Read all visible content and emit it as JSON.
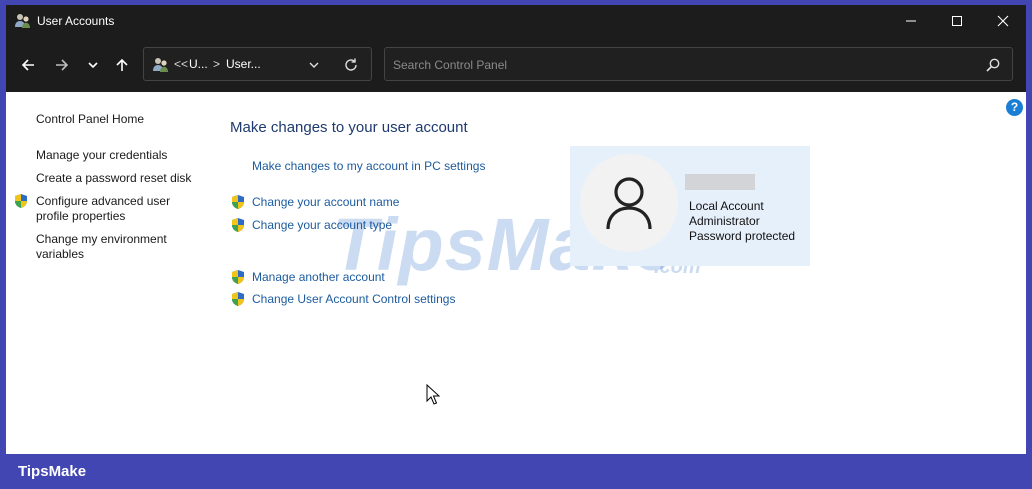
{
  "window": {
    "title": "User Accounts",
    "app_icon": "user-accounts-icon"
  },
  "navbar": {
    "address": {
      "overflow": "<<",
      "crumb1": "U...",
      "separator": ">",
      "crumb2": "User..."
    },
    "search": {
      "placeholder": "Search Control Panel"
    }
  },
  "leftnav": {
    "home": "Control Panel Home",
    "items": [
      "Manage your credentials",
      "Create a password reset disk",
      "Configure advanced user",
      "profile properties",
      "Change my environment",
      "variables"
    ]
  },
  "main": {
    "title": "Make changes to your user account",
    "pc_settings_link": "Make changes to my account in PC settings",
    "tasks": [
      "Change your account name",
      "Change your account type",
      "Manage another account",
      "Change User Account Control settings"
    ]
  },
  "account": {
    "lines": [
      "Local Account",
      "Administrator",
      "Password protected"
    ]
  },
  "watermark": {
    "text": "TipsMake",
    "suffix": ".com"
  },
  "footer": {
    "brand": "TipsMake"
  },
  "colors": {
    "titlebar": "#1c1c1c",
    "link": "#1c5b9e",
    "heading": "#1e3a6e",
    "frame": "#4146b3",
    "account_card": "#e6f0fb"
  }
}
